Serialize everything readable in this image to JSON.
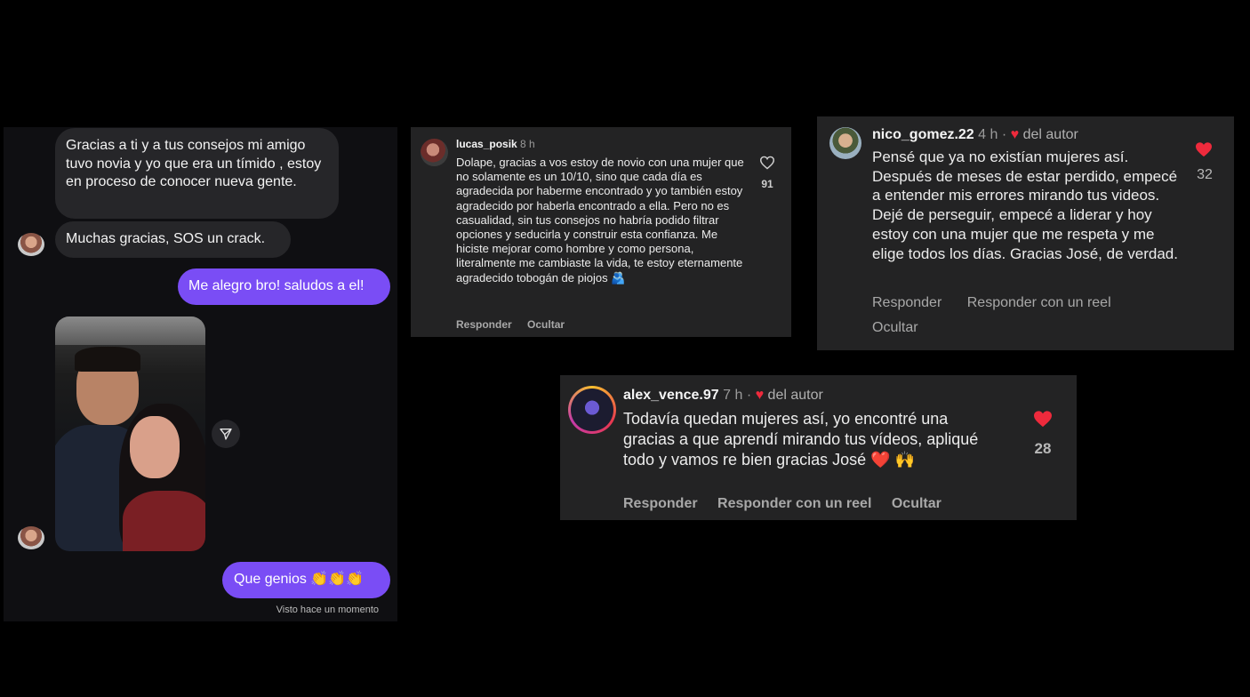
{
  "dm": {
    "messages": [
      {
        "from": "them",
        "text": "Gracias a ti y a tus consejos mi amigo tuvo novia y yo que era un tímido , estoy en proceso de conocer nueva gente."
      },
      {
        "from": "them",
        "text": "Muchas gracias, SOS un crack."
      },
      {
        "from": "me",
        "text": "Me alegro bro! saludos a el!"
      },
      {
        "from": "me",
        "text": "Que genios 👏👏👏"
      }
    ],
    "seen": "Visto hace un momento"
  },
  "comments": [
    {
      "username": "lucas_posik",
      "time": "8 h",
      "text": "Dolape, gracias a vos estoy de novio con una mujer que no solamente es un 10/10, sino que cada día es agradecida por haberme encontrado y yo también estoy agradecido por haberla encontrado a ella. Pero no es casualidad, sin tus consejos no habría podido filtrar opciones y seducirla y construir esta confianza. Me hiciste mejorar como hombre y como persona, literalmente me cambiaste la vida, te estoy eternamente agradecido tobogán de piojos 🫂",
      "likes": "91",
      "actions": [
        "Responder",
        "Ocultar"
      ]
    },
    {
      "username": "nico_gomez.22",
      "time": "4 h",
      "author_label": "del autor",
      "text": "Pensé que ya no existían mujeres así. Después de meses de estar perdido, empecé a entender mis errores mirando tus videos. Dejé de perseguir, empecé a liderar y hoy estoy con una mujer que me respeta y me elige todos los días. Gracias José, de verdad.",
      "likes": "32",
      "actions": [
        "Responder",
        "Responder con un reel",
        "Ocultar"
      ]
    },
    {
      "username": "alex_vence.97",
      "time": "7 h",
      "author_label": "del autor",
      "text": "Todavía quedan mujeres así, yo encontré una gracias a que aprendí mirando tus vídeos, apliqué todo y vamos re bien gracias José ❤️ 🙌",
      "likes": "28",
      "actions": [
        "Responder",
        "Responder con un reel",
        "Ocultar"
      ]
    }
  ],
  "colors": {
    "accent_purple": "#7a4df5",
    "heart_red": "#ee2a3c",
    "panel_bg": "#232324"
  },
  "icons": [
    "share-icon",
    "heart-outline-icon",
    "heart-filled-icon"
  ]
}
